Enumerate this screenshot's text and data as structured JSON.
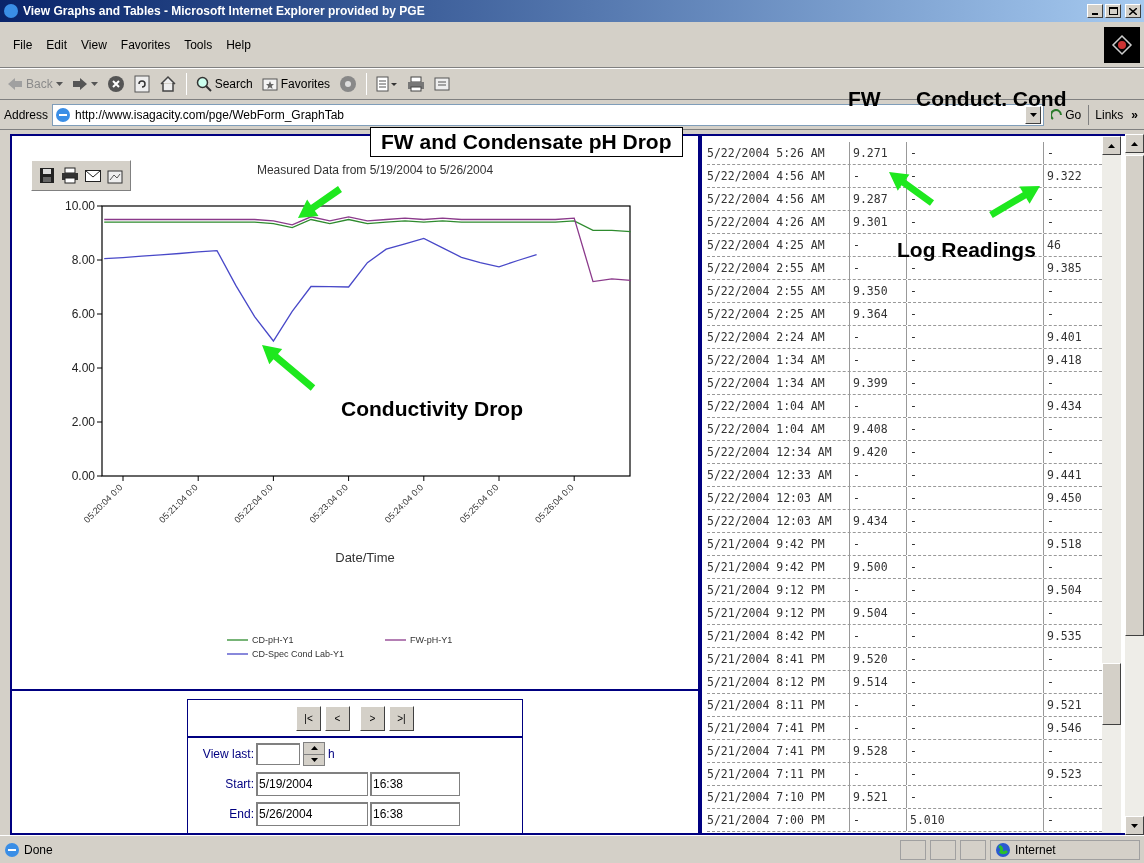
{
  "window": {
    "title": "View Graphs and Tables - Microsoft Internet Explorer provided by PGE"
  },
  "menu": [
    "File",
    "Edit",
    "View",
    "Favorites",
    "Tools",
    "Help"
  ],
  "toolbar": [
    {
      "kind": "back",
      "label": "Back",
      "disabled": true
    },
    {
      "kind": "forward",
      "disabled": false
    },
    {
      "kind": "stop"
    },
    {
      "kind": "refresh"
    },
    {
      "kind": "home"
    },
    {
      "kind": "search",
      "label": "Search"
    },
    {
      "kind": "favorites",
      "label": "Favorites"
    },
    {
      "kind": "media"
    },
    {
      "kind": "edit"
    },
    {
      "kind": "print"
    },
    {
      "kind": "note"
    }
  ],
  "address": {
    "label": "Address",
    "value": "http://www.isagacity.com/pge/WebForm_GraphTab",
    "go": "Go",
    "links": "Links",
    "more": "»"
  },
  "chart": {
    "chart_data": {
      "type": "line",
      "title": "Measured Data from 5/19/2004 to 5/26/2004",
      "xlabel": "Date/Time",
      "ylim": [
        0,
        10
      ],
      "legend": true,
      "categories": [
        null,
        "05:20:04 0:0",
        null,
        null,
        null,
        "05:21:04 0:0",
        null,
        null,
        null,
        "05:22:04 0:0",
        null,
        null,
        null,
        "05:23:04 0:0",
        null,
        null,
        null,
        "05:24:04 0:0",
        null,
        null,
        null,
        "05:25:04 0:0",
        null,
        null,
        null,
        "05:26:04 0:0",
        null,
        null,
        null
      ],
      "series": [
        {
          "name": "CD-pH-Y1",
          "color": "#2e8b2e",
          "values": [
            9.4,
            9.4,
            9.4,
            9.4,
            9.4,
            9.4,
            9.4,
            9.4,
            9.4,
            9.35,
            9.2,
            9.5,
            9.35,
            9.5,
            9.35,
            9.4,
            9.45,
            9.4,
            9.45,
            9.4,
            9.4,
            9.4,
            9.4,
            9.4,
            9.4,
            9.45,
            9.1,
            9.1,
            9.05
          ]
        },
        {
          "name": "FW-pH-Y1",
          "color": "#8b3a8b",
          "values": [
            9.5,
            9.5,
            9.5,
            9.5,
            9.5,
            9.5,
            9.5,
            9.5,
            9.5,
            9.45,
            9.3,
            9.6,
            9.45,
            9.6,
            9.45,
            9.5,
            9.55,
            9.5,
            9.55,
            9.5,
            9.5,
            9.5,
            9.5,
            9.5,
            9.5,
            9.55,
            7.2,
            7.3,
            7.25
          ]
        },
        {
          "name": "CD-Spec Cond Lab-Y1",
          "color": "#4848c8",
          "values": [
            8.05,
            8.09,
            8.14,
            8.19,
            8.24,
            8.3,
            8.35,
            7.06,
            5.9,
            5.0,
            6.1,
            7.02,
            7.01,
            7.0,
            7.9,
            8.4,
            8.6,
            8.8,
            8.45,
            8.1,
            7.9,
            7.75,
            7.98,
            8.2,
            null,
            null,
            null,
            null,
            null
          ]
        }
      ],
      "yticks": [
        {
          "value": 0,
          "label": "0.00"
        },
        {
          "value": 2,
          "label": "2.00"
        },
        {
          "value": 4,
          "label": "4.00"
        },
        {
          "value": 6,
          "label": "6.00"
        },
        {
          "value": 8,
          "label": "8.00"
        },
        {
          "value": 10,
          "label": "10.00"
        }
      ]
    }
  },
  "navigation": {
    "buttons": [
      "|<",
      "<",
      ">",
      ">|"
    ],
    "view_last": {
      "label": "View last:",
      "unit": "h"
    },
    "start": {
      "label": "Start:",
      "date": "5/19/2004",
      "time": "16:38"
    },
    "end": {
      "label": "End:",
      "date": "5/26/2004",
      "time": "16:38"
    }
  },
  "table": {
    "rows": [
      [
        "5/22/2004 5:26 AM",
        "9.271",
        "-",
        "-"
      ],
      [
        "5/22/2004 4:56 AM",
        "-",
        "-",
        "9.322"
      ],
      [
        "5/22/2004 4:56 AM",
        "9.287",
        "-",
        "-"
      ],
      [
        "5/22/2004 4:26 AM",
        "9.301",
        "-",
        "-"
      ],
      [
        "5/22/2004 4:25 AM",
        "-",
        null,
        "46"
      ],
      [
        "5/22/2004 2:55 AM",
        "-",
        "-",
        "9.385"
      ],
      [
        "5/22/2004 2:55 AM",
        "9.350",
        "-",
        "-"
      ],
      [
        "5/22/2004 2:25 AM",
        "9.364",
        "-",
        "-"
      ],
      [
        "5/22/2004 2:24 AM",
        "-",
        "-",
        "9.401"
      ],
      [
        "5/22/2004 1:34 AM",
        "-",
        "-",
        "9.418"
      ],
      [
        "5/22/2004 1:34 AM",
        "9.399",
        "-",
        "-"
      ],
      [
        "5/22/2004 1:04 AM",
        "-",
        "-",
        "9.434"
      ],
      [
        "5/22/2004 1:04 AM",
        "9.408",
        "-",
        "-"
      ],
      [
        "5/22/2004 12:34 AM",
        "9.420",
        "-",
        "-"
      ],
      [
        "5/22/2004 12:33 AM",
        "-",
        "-",
        "9.441"
      ],
      [
        "5/22/2004 12:03 AM",
        "-",
        "-",
        "9.450"
      ],
      [
        "5/22/2004 12:03 AM",
        "9.434",
        "-",
        "-"
      ],
      [
        "5/21/2004 9:42 PM",
        "-",
        "-",
        "9.518"
      ],
      [
        "5/21/2004 9:42 PM",
        "9.500",
        "-",
        "-"
      ],
      [
        "5/21/2004 9:12 PM",
        "-",
        "-",
        "9.504"
      ],
      [
        "5/21/2004 9:12 PM",
        "9.504",
        "-",
        "-"
      ],
      [
        "5/21/2004 8:42 PM",
        "-",
        "-",
        "9.535"
      ],
      [
        "5/21/2004 8:41 PM",
        "9.520",
        "-",
        "-"
      ],
      [
        "5/21/2004 8:12 PM",
        "9.514",
        "-",
        "-"
      ],
      [
        "5/21/2004 8:11 PM",
        "-",
        "-",
        "9.521"
      ],
      [
        "5/21/2004 7:41 PM",
        "-",
        "-",
        "9.546"
      ],
      [
        "5/21/2004 7:41 PM",
        "9.528",
        "-",
        "-"
      ],
      [
        "5/21/2004 7:11 PM",
        "-",
        "-",
        "9.523"
      ],
      [
        "5/21/2004 7:10 PM",
        "9.521",
        "-",
        "-"
      ],
      [
        "5/21/2004 7:00 PM",
        "-",
        "5.010",
        "-"
      ]
    ]
  },
  "annotations": [
    {
      "kind": "callout",
      "text": "FW and Condensate pH Drop"
    },
    {
      "kind": "label",
      "text": "Conductivity Drop"
    },
    {
      "kind": "label",
      "text": "Log Readings"
    },
    {
      "kind": "label",
      "text": "FW"
    },
    {
      "kind": "label",
      "text": "Conduct. Cond"
    }
  ],
  "status_bar": {
    "text": "Done",
    "zone": "Internet"
  }
}
